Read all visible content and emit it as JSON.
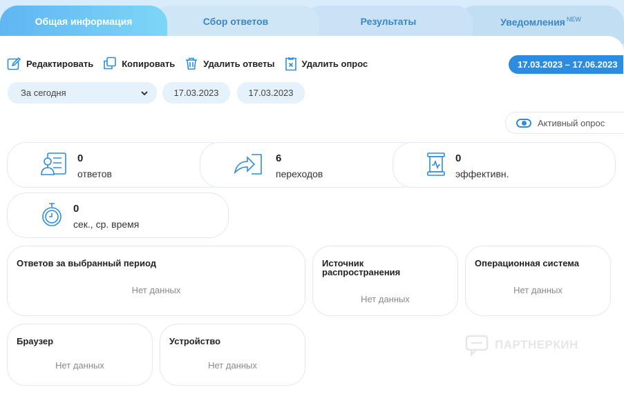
{
  "tabs": [
    {
      "label": "Общая информация"
    },
    {
      "label": "Сбор ответов"
    },
    {
      "label": "Результаты"
    },
    {
      "label": "Уведомления",
      "badge": "NEW"
    }
  ],
  "toolbar": {
    "edit_label": "Редактировать",
    "copy_label": "Копировать",
    "delete_answers_label": "Удалить ответы",
    "delete_survey_label": "Удалить опрос"
  },
  "date_range_badge": "17.03.2023 – 17.06.2023",
  "filters": {
    "period_selected": "За сегодня",
    "date_from": "17.03.2023",
    "date_to": "17.03.2023"
  },
  "active_toggle": {
    "label": "Активный опрос",
    "on": true
  },
  "stats": [
    {
      "value": "0",
      "label": "ответов",
      "icon": "answers-icon"
    },
    {
      "value": "6",
      "label": "переходов",
      "icon": "redirect-arrow-icon"
    },
    {
      "value": "0",
      "label": "эффективн.",
      "icon": "efficiency-icon"
    },
    {
      "value": "0",
      "label": "сек., ср. время",
      "icon": "stopwatch-icon"
    }
  ],
  "panels": [
    {
      "title": "Ответов за выбранный период",
      "empty": "Нет данных"
    },
    {
      "title": "Источник распространения",
      "empty": "Нет данных"
    },
    {
      "title": "Операционная система",
      "empty": "Нет данных"
    },
    {
      "title": "Браузер",
      "empty": "Нет данных"
    },
    {
      "title": "Устройство",
      "empty": "Нет данных"
    }
  ],
  "watermark": "ПАРТНЕРКИН",
  "colors": {
    "accent": "#2c8ce0",
    "tab_active": "#5fb6f2",
    "muted": "#8a8a8a"
  }
}
